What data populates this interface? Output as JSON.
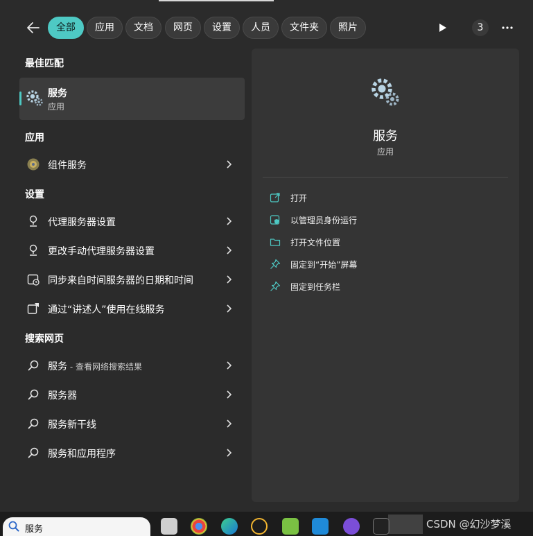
{
  "filters": {
    "tabs": [
      "全部",
      "应用",
      "文档",
      "网页",
      "设置",
      "人员",
      "文件夹",
      "照片"
    ],
    "badge_count": "3"
  },
  "left": {
    "best_match_heading": "最佳匹配",
    "best_match": {
      "title": "服务",
      "subtitle": "应用"
    },
    "apps_heading": "应用",
    "apps": [
      {
        "label": "组件服务"
      }
    ],
    "settings_heading": "设置",
    "settings": [
      {
        "label": "代理服务器设置"
      },
      {
        "label": "更改手动代理服务器设置"
      },
      {
        "label": "同步来自时间服务器的日期和时间"
      },
      {
        "label": "通过“讲述人”使用在线服务"
      }
    ],
    "web_heading": "搜索网页",
    "web": [
      {
        "label": "服务",
        "suffix": " - 查看网络搜索结果"
      },
      {
        "label": "服务器"
      },
      {
        "label": "服务新干线"
      },
      {
        "label": "服务和应用程序"
      }
    ]
  },
  "detail": {
    "title": "服务",
    "kind": "应用",
    "actions": [
      {
        "label": "打开",
        "icon": "open-external-icon"
      },
      {
        "label": "以管理员身份运行",
        "icon": "shield-admin-icon"
      },
      {
        "label": "打开文件位置",
        "icon": "folder-icon"
      },
      {
        "label": "固定到“开始”屏幕",
        "icon": "pin-icon"
      },
      {
        "label": "固定到任务栏",
        "icon": "pin-icon"
      }
    ]
  },
  "taskbar": {
    "search_value": "服务",
    "watermark": "CSDN @幻沙梦溪"
  },
  "colors": {
    "accent": "#4ec9c4",
    "panel": "#2b2b2b",
    "detail_bg": "#343434"
  }
}
